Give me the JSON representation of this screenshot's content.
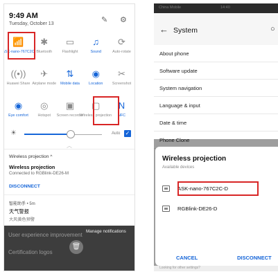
{
  "left": {
    "time": "9:49 AM",
    "date": "Tuesday, October 13",
    "header_icons": [
      "✎",
      "⚙"
    ],
    "tiles": [
      [
        {
          "icon": "wifi-icon",
          "glyph": "📶",
          "label": "ASK-nano-767C2C",
          "on": true
        },
        {
          "icon": "bluetooth-icon",
          "glyph": "✱",
          "label": "Bluetooth",
          "on": false
        },
        {
          "icon": "flashlight-icon",
          "glyph": "▭",
          "label": "Flashlight",
          "on": false
        },
        {
          "icon": "bell-icon",
          "glyph": "♫",
          "label": "Sound",
          "on": true
        },
        {
          "icon": "autorotate-icon",
          "glyph": "⟳",
          "label": "Auto-rotate",
          "on": false
        }
      ],
      [
        {
          "icon": "huawei-share-icon",
          "glyph": "((•))",
          "label": "Huawei Share",
          "on": false
        },
        {
          "icon": "airplane-icon",
          "glyph": "✈",
          "label": "Airplane mode",
          "on": false
        },
        {
          "icon": "mobile-data-icon",
          "glyph": "⇅",
          "label": "Mobile data",
          "on": true
        },
        {
          "icon": "location-icon",
          "glyph": "◉",
          "label": "Location",
          "on": true
        },
        {
          "icon": "screenshot-icon",
          "glyph": "✂",
          "label": "Screenshot",
          "on": false
        }
      ],
      [
        {
          "icon": "eye-comfort-icon",
          "glyph": "◉",
          "label": "Eye comfort",
          "on": true
        },
        {
          "icon": "hotspot-icon",
          "glyph": "◎",
          "label": "Hotspot",
          "on": false
        },
        {
          "icon": "screen-recorder-icon",
          "glyph": "▣",
          "label": "Screen recorder",
          "on": false
        },
        {
          "icon": "wireless-projection-icon",
          "glyph": "▢",
          "label": "Wireless projection",
          "on": false
        },
        {
          "icon": "nfc-icon",
          "glyph": "N",
          "label": "NFC",
          "on": true
        }
      ]
    ],
    "brightness": {
      "auto_label": "Auto",
      "check": "✓",
      "level": 0.6
    },
    "notification": {
      "title": "Wireless projection ^",
      "heading": "Wireless projection",
      "subtitle": "Connected to RGBlink-DE26-M",
      "action": "DISCONNECT"
    },
    "notification2": {
      "source": "智能助手 • 5m",
      "title": "天气警报",
      "body": "大风黄色预警"
    },
    "dark": {
      "line1": "User experience improvement",
      "manage": "Manage notifications",
      "line2": "Certification logos",
      "trash_glyph": "🗑"
    }
  },
  "right": {
    "status": "China Mobile",
    "status_right": "14:40",
    "title": "System",
    "items": [
      "About phone",
      "Software update",
      "System navigation",
      "Language & input",
      "Date & time",
      "Phone Clone"
    ],
    "dialog": {
      "title": "Wireless projection",
      "subtitle": "Available devices",
      "devices": [
        "ASK-nano-767C2C-D",
        "RGBlink-DE26-D"
      ],
      "cancel": "CANCEL",
      "disconnect": "DISCONNECT"
    },
    "footer": "Looking for other settings?"
  }
}
